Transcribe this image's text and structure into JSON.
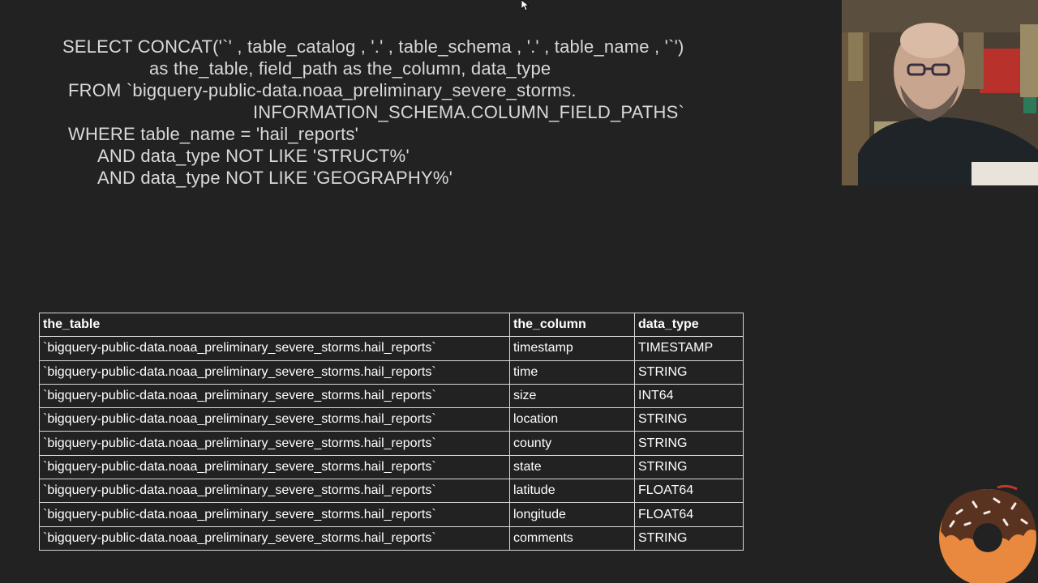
{
  "sql": {
    "lines": [
      "SELECT CONCAT('`' , table_catalog , '.' , table_schema , '.' , table_name , '`')",
      "as the_table, field_path as the_column, data_type",
      "FROM `bigquery-public-data.noaa_preliminary_severe_storms.",
      "INFORMATION_SCHEMA.COLUMN_FIELD_PATHS`",
      "WHERE table_name = 'hail_reports'",
      "AND data_type NOT LIKE 'STRUCT%'",
      "AND data_type NOT LIKE 'GEOGRAPHY%'"
    ]
  },
  "results": {
    "headers": [
      "the_table",
      "the_column",
      "data_type"
    ],
    "rows": [
      [
        "`bigquery-public-data.noaa_preliminary_severe_storms.hail_reports`",
        "timestamp",
        "TIMESTAMP"
      ],
      [
        "`bigquery-public-data.noaa_preliminary_severe_storms.hail_reports`",
        "time",
        "STRING"
      ],
      [
        "`bigquery-public-data.noaa_preliminary_severe_storms.hail_reports`",
        "size",
        "INT64"
      ],
      [
        "`bigquery-public-data.noaa_preliminary_severe_storms.hail_reports`",
        "location",
        "STRING"
      ],
      [
        "`bigquery-public-data.noaa_preliminary_severe_storms.hail_reports`",
        "county",
        "STRING"
      ],
      [
        "`bigquery-public-data.noaa_preliminary_severe_storms.hail_reports`",
        "state",
        "STRING"
      ],
      [
        "`bigquery-public-data.noaa_preliminary_severe_storms.hail_reports`",
        "latitude",
        "FLOAT64"
      ],
      [
        "`bigquery-public-data.noaa_preliminary_severe_storms.hail_reports`",
        "longitude",
        "FLOAT64"
      ],
      [
        "`bigquery-public-data.noaa_preliminary_severe_storms.hail_reports`",
        "comments",
        "STRING"
      ]
    ]
  },
  "overlays": {
    "webcam_icon": "presenter-webcam",
    "logo_icon": "donut-logo-icon",
    "cursor_icon": "mouse-cursor-icon"
  },
  "colors": {
    "background": "#222222",
    "text": "#f0f0f0",
    "border": "#d8d8d8",
    "donut_dough": "#e8893f",
    "donut_chocolate": "#5a3220"
  }
}
